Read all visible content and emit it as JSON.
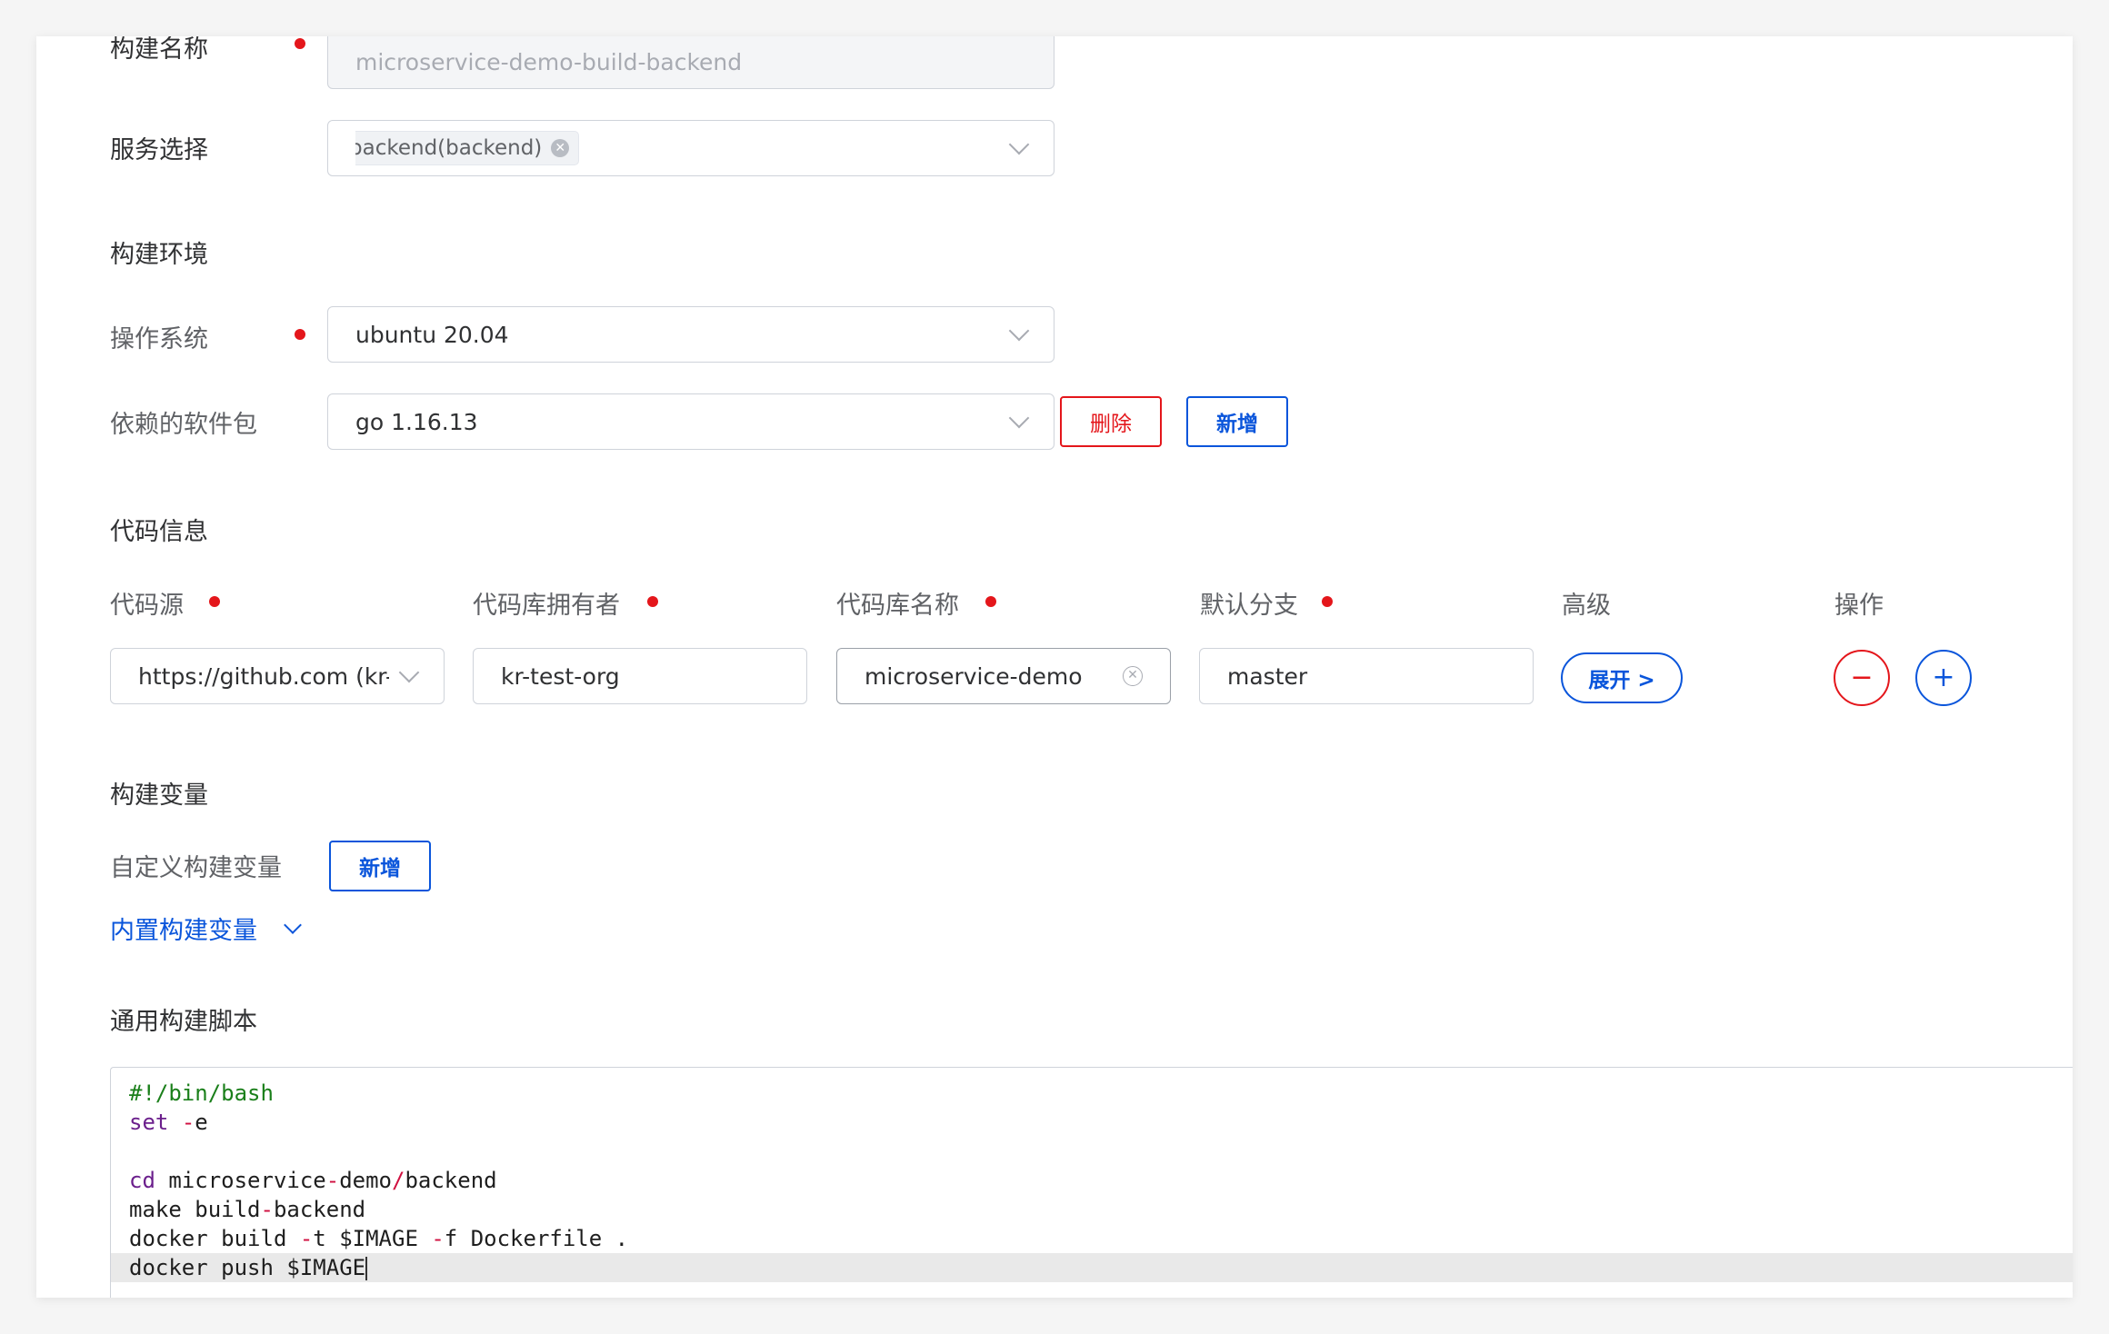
{
  "form": {
    "build_name": {
      "label": "构建名称",
      "value": "microservice-demo-build-backend"
    },
    "service": {
      "label": "服务选择",
      "tag": "backend(backend)"
    }
  },
  "env": {
    "title": "构建环境",
    "os": {
      "label": "操作系统",
      "value": "ubuntu 20.04"
    },
    "deps": {
      "label": "依赖的软件包",
      "value": "go 1.16.13",
      "delete_label": "删除",
      "add_label": "新增"
    }
  },
  "code": {
    "title": "代码信息",
    "headers": {
      "source": "代码源",
      "owner": "代码库拥有者",
      "repo": "代码库名称",
      "branch": "默认分支",
      "advanced": "高级",
      "ops": "操作"
    },
    "row": {
      "source": "https://github.com (kr-t",
      "owner": "kr-test-org",
      "repo": "microservice-demo",
      "branch": "master",
      "expand_label": "展开 >"
    }
  },
  "vars": {
    "title": "构建变量",
    "custom_label": "自定义构建变量",
    "add_label": "新增",
    "builtin_label": "内置构建变量"
  },
  "script": {
    "title": "通用构建脚本"
  },
  "colors": {
    "accent": "#0a55db",
    "danger": "#e4161b"
  }
}
